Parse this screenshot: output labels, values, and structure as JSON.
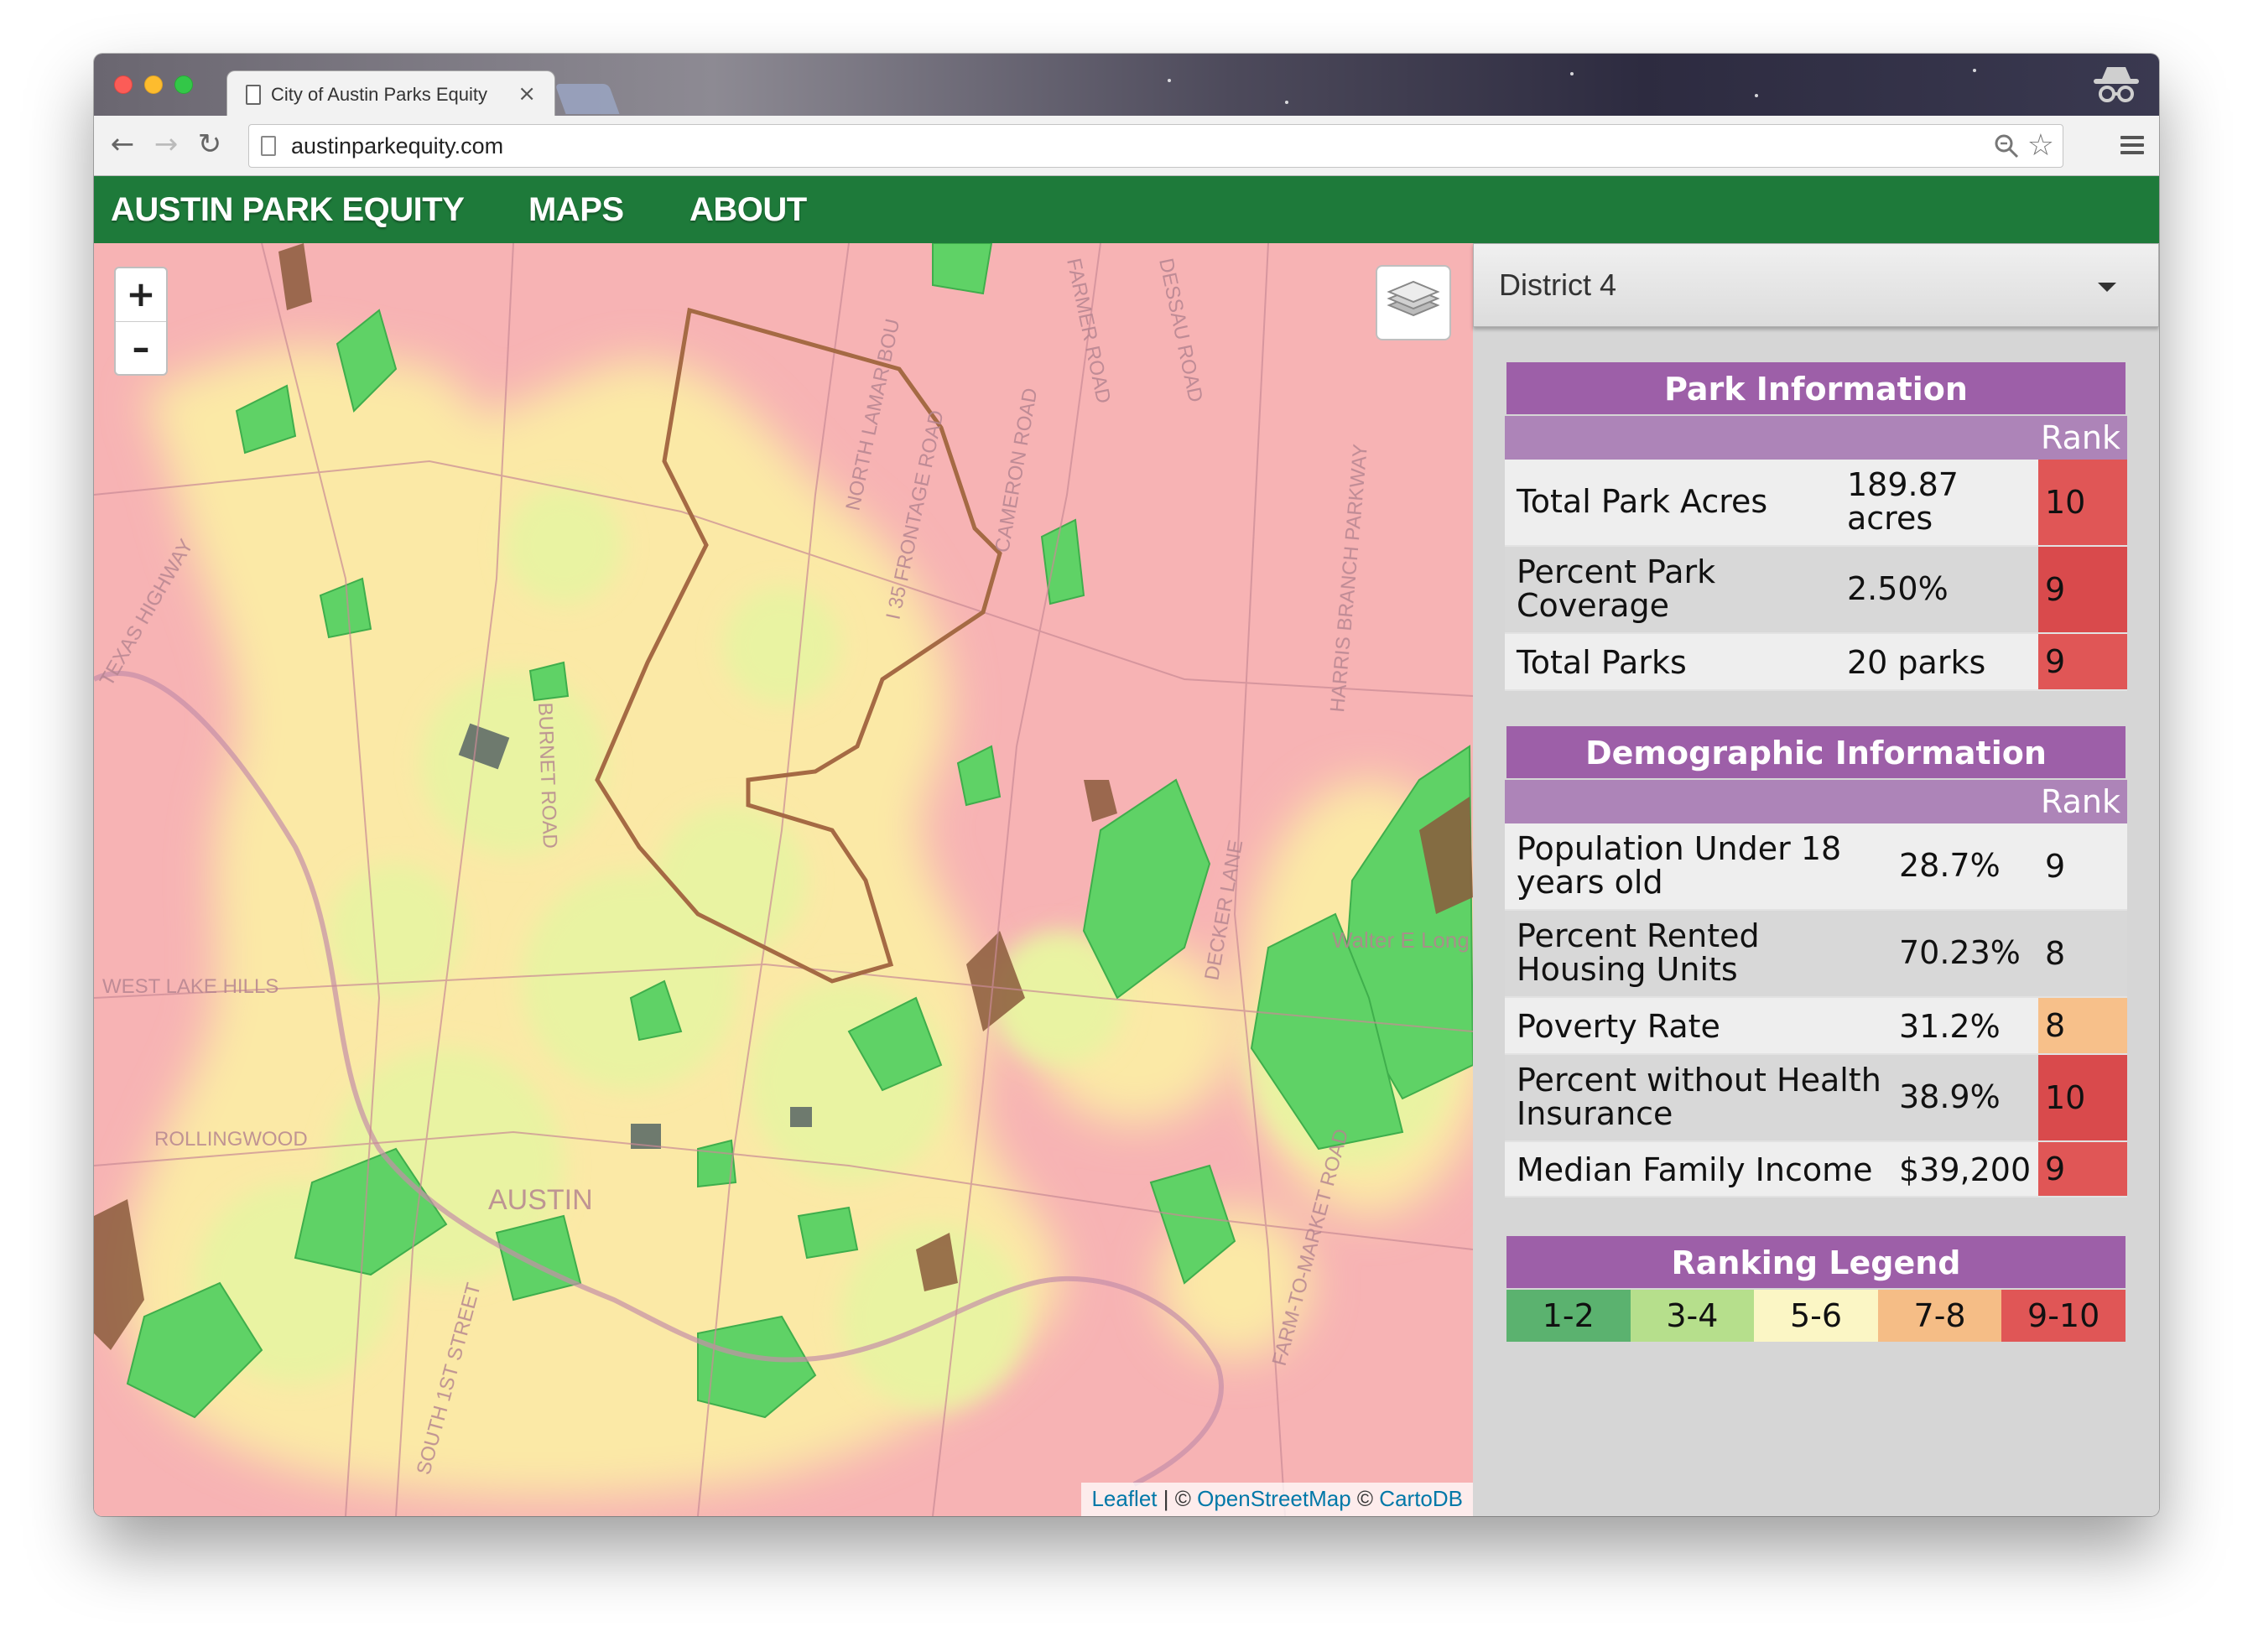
{
  "browser": {
    "tab_title": "City of Austin Parks Equity",
    "tab_close": "×",
    "url": "austinparkequity.com"
  },
  "nav": {
    "brand": "AUSTIN PARK EQUITY",
    "maps": "MAPS",
    "about": "ABOUT"
  },
  "map": {
    "zoom_in": "+",
    "zoom_out": "–",
    "attribution": {
      "leaflet": "Leaflet",
      "sep": " | © ",
      "osm": "OpenStreetMap",
      "sep2": " © ",
      "carto": "CartoDB"
    },
    "labels": {
      "west_lake": "WEST LAKE HILLS",
      "rollingwood": "ROLLINGWOOD",
      "austin": "AUSTIN",
      "burnet": "BURNET ROAD",
      "lamar": "NORTH LAMAR BOU",
      "frontage": "I 35 FRONTAGE ROAD",
      "cameron": "CAMERON ROAD",
      "harris_branch": "HARRIS BRANCH PARKWAY",
      "decker": "DECKER LANE",
      "walter": "Walter E Long Metropolitan Park",
      "farm": "FARM-TO-MARKET ROAD",
      "south": "SOUTH 1ST STREET",
      "texas": "TEXAS HIGHWAY",
      "farmer": "FARMER ROAD",
      "dessau": "DESSAU ROAD"
    },
    "colors": {
      "low": "#f7b3b4",
      "mid": "#fbe7a8",
      "high": "#e6f2a0",
      "park": "#5fd266",
      "park_dark": "#8b5a3c",
      "district_line": "#a56a44"
    }
  },
  "sidebar": {
    "district_select": "District 4",
    "park_info": {
      "title": "Park Information",
      "rank_header": "Rank",
      "rows": [
        {
          "label": "Total Park Acres",
          "value": "189.87 acres",
          "rank": "10",
          "color": "#e05656"
        },
        {
          "label": "Percent Park Coverage",
          "value": "2.50%",
          "rank": "9",
          "color": "#d94a4c"
        },
        {
          "label": "Total Parks",
          "value": "20 parks",
          "rank": "9",
          "color": "#e05656"
        }
      ]
    },
    "demographic_info": {
      "title": "Demographic Information",
      "rank_header": "Rank",
      "rows": [
        {
          "label": "Population Under 18 years old",
          "value": "28.7%",
          "rank": "9",
          "color": ""
        },
        {
          "label": "Percent Rented Housing Units",
          "value": "70.23%",
          "rank": "8",
          "color": ""
        },
        {
          "label": "Poverty Rate",
          "value": "31.2%",
          "rank": "8",
          "color": "#f7c08a"
        },
        {
          "label": "Percent without Health Insurance",
          "value": "38.9%",
          "rank": "10",
          "color": "#d94a4c"
        },
        {
          "label": "Median Family Income",
          "value": "$39,200",
          "rank": "9",
          "color": "#e05656"
        }
      ]
    },
    "legend": {
      "title": "Ranking Legend",
      "items": [
        {
          "label": "1-2",
          "color": "#5bb26f"
        },
        {
          "label": "3-4",
          "color": "#b6df8c"
        },
        {
          "label": "5-6",
          "color": "#fbf6c5"
        },
        {
          "label": "7-8",
          "color": "#f5bd86"
        },
        {
          "label": "9-10",
          "color": "#e05656"
        }
      ]
    }
  }
}
